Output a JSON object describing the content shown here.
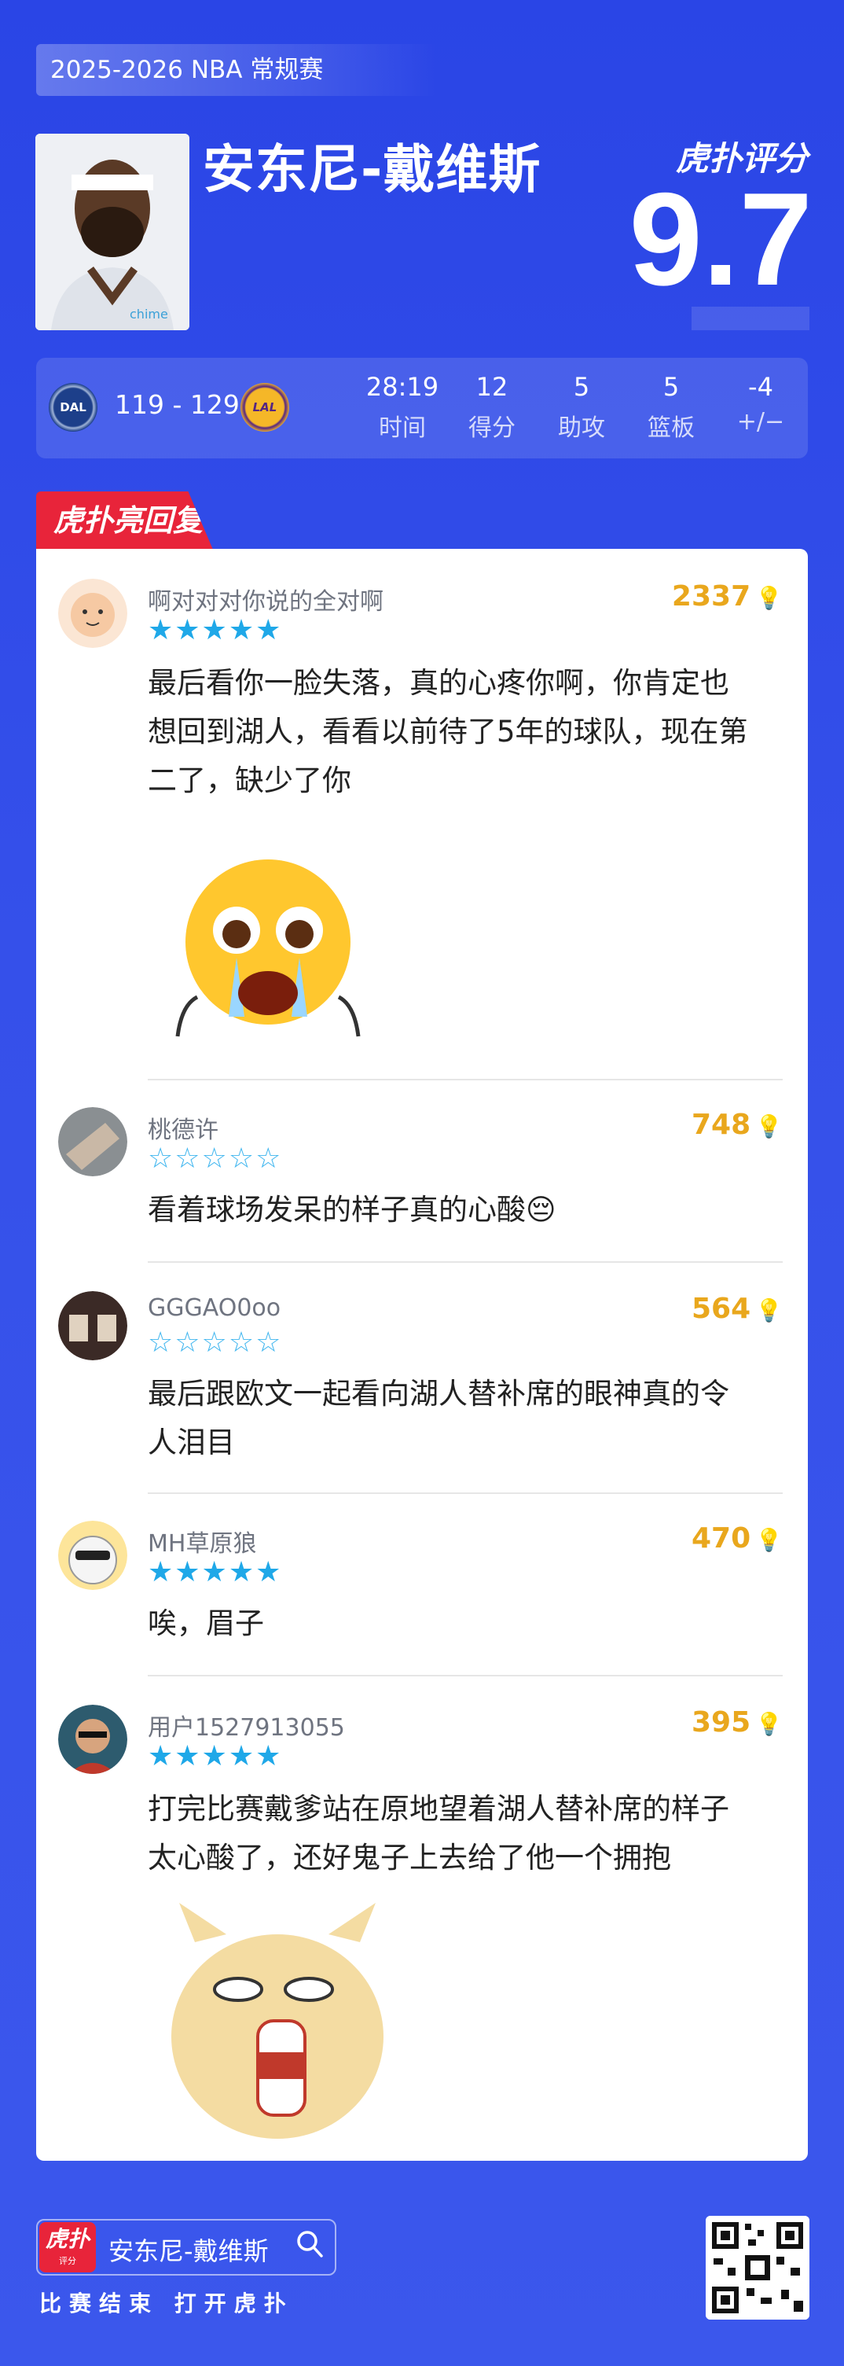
{
  "header": {
    "season": "2025-2026 NBA 常规赛",
    "player_name": "安东尼-戴维斯",
    "brand_logo": "虎扑评分",
    "rating": "9.7"
  },
  "game": {
    "home_team": "DAL",
    "away_team": "LAL",
    "score": "119 - 129",
    "stats": [
      {
        "value": "28:19",
        "label": "时间"
      },
      {
        "value": "12",
        "label": "得分"
      },
      {
        "value": "5",
        "label": "助攻"
      },
      {
        "value": "5",
        "label": "篮板"
      },
      {
        "value": "-4",
        "label": "+/−"
      }
    ]
  },
  "comments_tag": "虎扑亮回复",
  "comments": [
    {
      "user": "啊对对对你说的全对啊",
      "likes": "2337",
      "rating": 5,
      "lines": [
        "最后看你一脸失落，真的心疼你啊，你肯定也",
        "想回到湖人，看看以前待了5年的球队，现在第",
        "二了，缺少了你"
      ],
      "stars": "★★★★★"
    },
    {
      "user": "桃德许",
      "likes": "748",
      "rating": 0,
      "lines": [
        "看着球场发呆的样子真的心酸😔"
      ],
      "stars": "☆☆☆☆☆"
    },
    {
      "user": "GGGAO0oo",
      "likes": "564",
      "rating": 0,
      "lines": [
        "最后跟欧文一起看向湖人替补席的眼神真的令",
        "人泪目"
      ],
      "stars": "☆☆☆☆☆"
    },
    {
      "user": "MH草原狼",
      "likes": "470",
      "rating": 5,
      "lines": [
        "唉，眉子"
      ],
      "stars": "★★★★★"
    },
    {
      "user": "用户1527913055",
      "likes": "395",
      "rating": 5,
      "lines": [
        "打完比赛戴爹站在原地望着湖人替补席的样子",
        "太心酸了，还好鬼子上去给了他一个拥抱"
      ],
      "stars": "★★★★★"
    }
  ],
  "footer": {
    "logo_text": "虎扑",
    "logo_sub": "评分",
    "search_text": "安东尼-戴维斯",
    "caption": "比赛结束 打开虎扑"
  },
  "colors": {
    "background": "#2a45e6",
    "accent_red": "#e8243a",
    "likes_gold": "#e9a71d",
    "star_blue": "#1fa8e8"
  }
}
